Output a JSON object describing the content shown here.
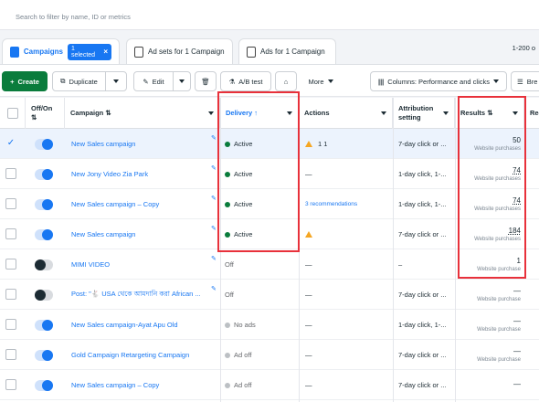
{
  "search": {
    "placeholder": "Search to filter by name, ID or metrics"
  },
  "tabs": {
    "campaigns_label": "Campaigns",
    "selected_badge": "1 selected",
    "adsets_label": "Ad sets for 1 Campaign",
    "ads_label": "Ads for 1 Campaign",
    "range_label": "1-200 o"
  },
  "toolbar": {
    "create_label": "Create",
    "duplicate_label": "Duplicate",
    "edit_label": "Edit",
    "ab_label": "A/B test",
    "more_label": "More",
    "columns_label": "Columns: Performance and clicks",
    "breakdown_label": "Bre"
  },
  "headers": {
    "onoff": "Off/On",
    "campaign": "Campaign",
    "delivery": "Delivery",
    "actions": "Actions",
    "attribution": "Attribution setting",
    "results": "Results",
    "extra": "Rea"
  },
  "rows": [
    {
      "name": "New Sales campaign",
      "delivery": "Active",
      "actions": "1   1",
      "attribution": "7-day click or ...",
      "result": "50",
      "result_sub": "Website purchases"
    },
    {
      "name": "New Jony Video Zia Park",
      "delivery": "Active",
      "actions": "—",
      "attribution": "1-day click, 1-...",
      "result": "74",
      "result_sub": "Website purchases"
    },
    {
      "name": "New Sales campaign – Copy",
      "delivery": "Active",
      "actions": "3 recommendations",
      "attribution": "1-day click, 1-...",
      "result": "74",
      "result_sub": "Website purchases"
    },
    {
      "name": "New Sales campaign",
      "delivery": "Active",
      "actions": "",
      "attribution": "7-day click or ...",
      "result": "184",
      "result_sub": "Website purchases"
    },
    {
      "name": "MIMI VIDEO",
      "delivery": "Off",
      "actions": "—",
      "attribution": "–",
      "result": "1",
      "result_sub": "Website purchase"
    },
    {
      "name": "Post: \"🐇 USA থেকে আমদানি করা African ...",
      "delivery": "Off",
      "actions": "—",
      "attribution": "7-day click or ...",
      "result": "—",
      "result_sub": "Website purchase"
    },
    {
      "name": "New Sales campaign-Ayat Apu Old",
      "delivery": "No ads",
      "actions": "—",
      "attribution": "1-day click, 1-...",
      "result": "—",
      "result_sub": "Website purchase"
    },
    {
      "name": "Gold Campaign Retargeting Campaign",
      "delivery": "Ad off",
      "actions": "—",
      "attribution": "7-day click or ...",
      "result": "—",
      "result_sub": "Website purchase"
    },
    {
      "name": "New Sales campaign – Copy",
      "delivery": "Ad off",
      "actions": "—",
      "attribution": "7-day click or ...",
      "result": "—",
      "result_sub": ""
    }
  ],
  "colors": {
    "accent": "#1877f2",
    "create": "#0a7c3c",
    "highlight": "#e8313b",
    "active_dot": "#0a7c3c"
  }
}
